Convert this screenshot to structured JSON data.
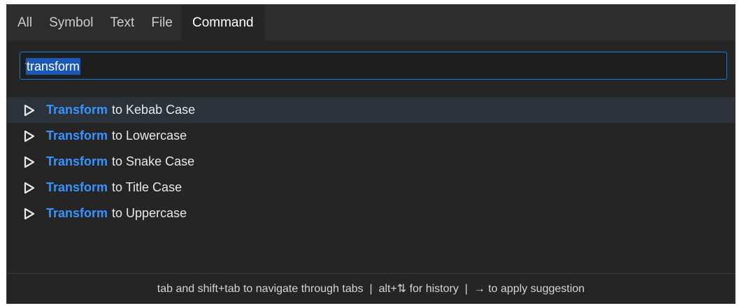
{
  "tabs": [
    {
      "label": "All",
      "active": false
    },
    {
      "label": "Symbol",
      "active": false
    },
    {
      "label": "Text",
      "active": false
    },
    {
      "label": "File",
      "active": false
    },
    {
      "label": "Command",
      "active": true
    }
  ],
  "search": {
    "value": "transform",
    "placeholder": ""
  },
  "results": [
    {
      "match": "Transform",
      "rest": "to Kebab Case",
      "selected": true
    },
    {
      "match": "Transform",
      "rest": "to Lowercase",
      "selected": false
    },
    {
      "match": "Transform",
      "rest": "to Snake Case",
      "selected": false
    },
    {
      "match": "Transform",
      "rest": "to Title Case",
      "selected": false
    },
    {
      "match": "Transform",
      "rest": "to Uppercase",
      "selected": false
    }
  ],
  "footer": {
    "hint": "tab and shift+tab to navigate through tabs  |  alt+⇅ for history  |  → to apply suggestion"
  },
  "colors": {
    "accent": "#3794ff",
    "focus_border": "#0e7fd6",
    "background": "#252526",
    "tabbar": "#2d2d2d"
  },
  "icons": {
    "result_icon": "play-outline-icon"
  }
}
